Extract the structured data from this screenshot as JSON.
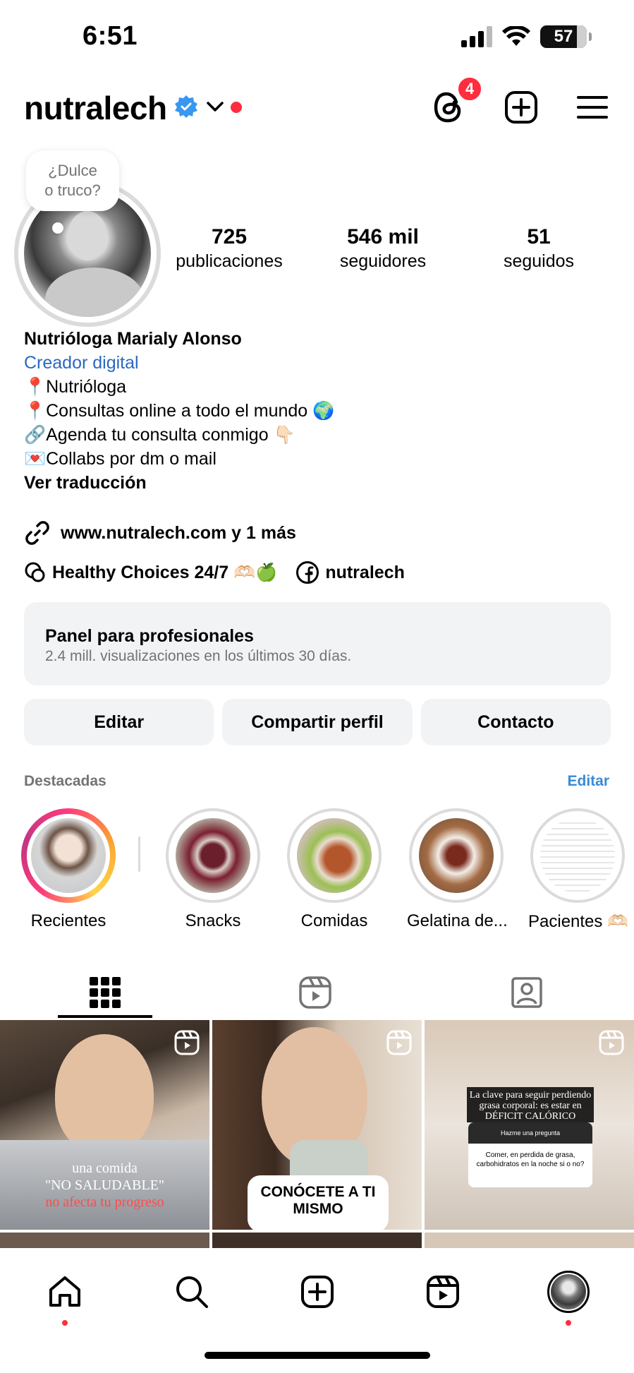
{
  "status_bar": {
    "time": "6:51",
    "battery": "57"
  },
  "header": {
    "username": "nutralech",
    "notifications_count": "4"
  },
  "profile": {
    "note": "¿Dulce o truco?",
    "stats": [
      {
        "value": "725",
        "label": "publicaciones"
      },
      {
        "value": "546 mil",
        "label": "seguidores"
      },
      {
        "value": "51",
        "label": "seguidos"
      }
    ],
    "name": "Nutrióloga Marialy Alonso",
    "category": "Creador digital",
    "bio_lines": [
      "📍Nutrióloga",
      "📍Consultas online a todo el mundo 🌍",
      "🔗Agenda tu consulta conmigo 👇🏻",
      "💌Collabs por dm o mail"
    ],
    "see_translation": "Ver traducción",
    "link": "www.nutralech.com y 1 más",
    "threads_label": "Healthy Choices 24/7 🫶🏻🍏",
    "facebook_label": "nutralech"
  },
  "dashboard": {
    "title": "Panel para profesionales",
    "subtitle": "2.4 mill. visualizaciones en los últimos 30 días."
  },
  "actions": {
    "edit": "Editar",
    "share": "Compartir perfil",
    "contact": "Contacto"
  },
  "highlights": {
    "section_label": "Destacadas",
    "edit_label": "Editar",
    "items": [
      {
        "label": "Recientes"
      },
      {
        "label": "Snacks"
      },
      {
        "label": "Comidas"
      },
      {
        "label": "Gelatina de..."
      },
      {
        "label": "Pacientes 🫶🏻"
      }
    ]
  },
  "posts": [
    {
      "overlay_line1": "una comida",
      "overlay_line2": "\"NO SALUDABLE\"",
      "overlay_line3": "no afecta tu progreso"
    },
    {
      "overlay_line1": "CONÓCETE A TI",
      "overlay_line2": "MISMO"
    },
    {
      "overlay_line1": "La clave para seguir perdiendo",
      "overlay_line2": "grasa corporal: es estar en",
      "overlay_line3": "DÉFICIT CALÓRICO",
      "question_header": "Hazme una pregunta",
      "question_text": "Comer, en perdida de grasa, carbohidratos en la noche si o no?"
    }
  ],
  "colors": {
    "accent_blue": "#3a8bd6",
    "category_blue": "#2b68c2",
    "badge_red": "#ff2d3d",
    "surface_gray": "#f2f3f5"
  },
  "icons": [
    "threads-icon",
    "create-icon",
    "menu-icon",
    "link-icon",
    "facebook-icon",
    "grid-icon",
    "reels-icon",
    "tagged-icon",
    "home-icon",
    "search-icon",
    "reels-nav-icon"
  ]
}
